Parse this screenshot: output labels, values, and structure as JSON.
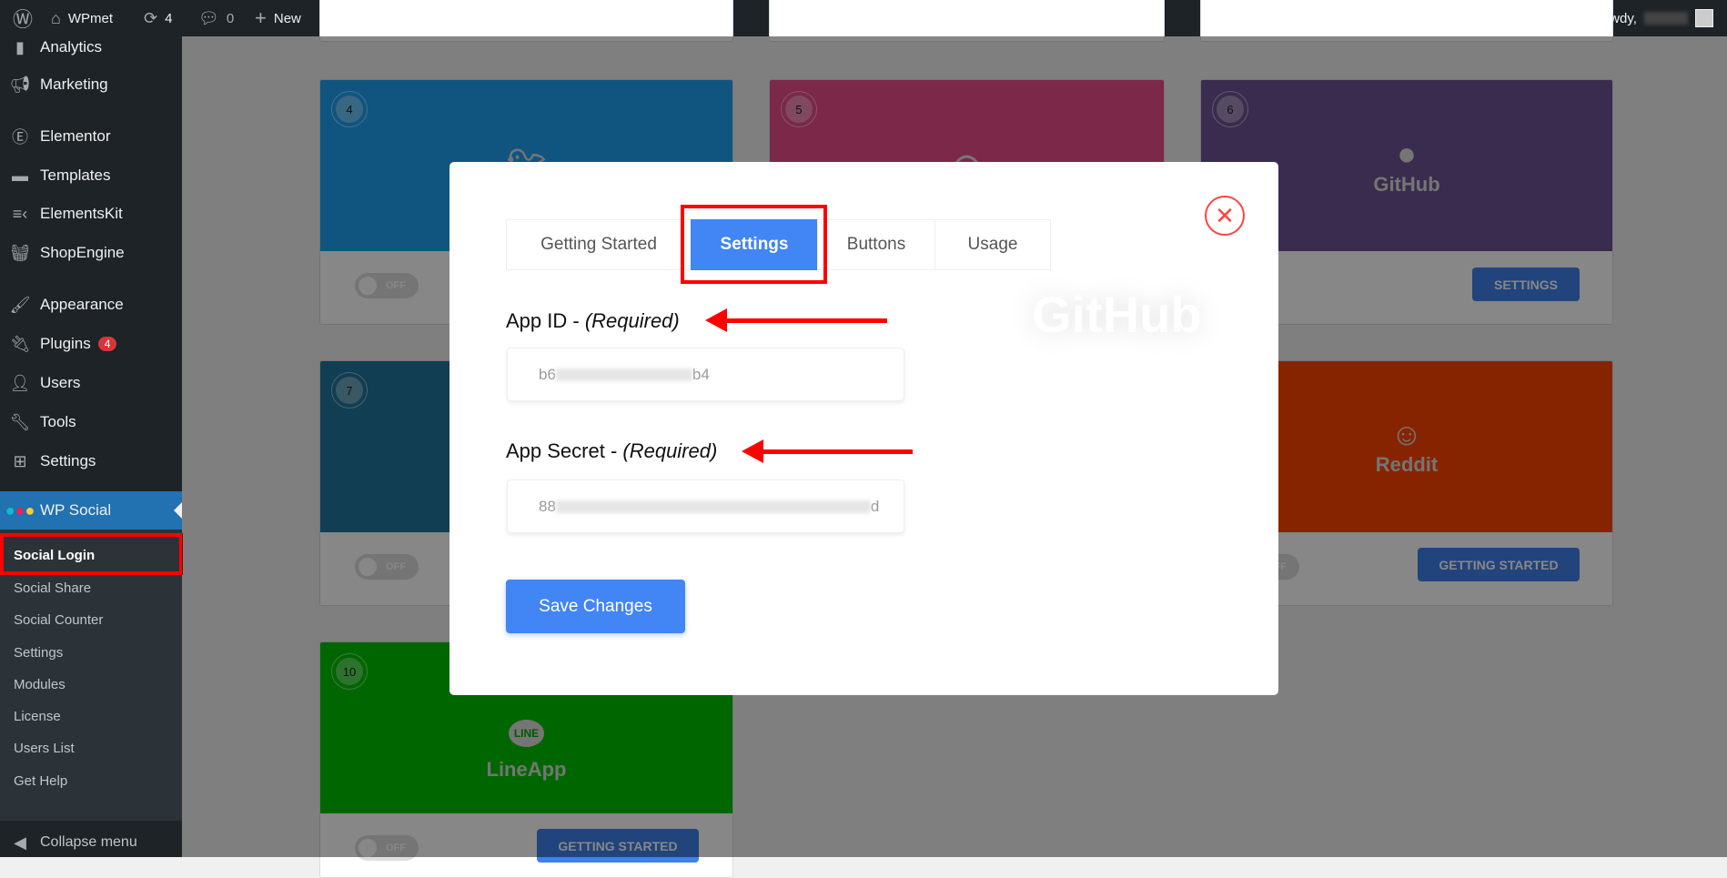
{
  "topbar": {
    "site": "WPmet",
    "updates": "4",
    "comments": "0",
    "new": "New",
    "howdy": "Howdy,"
  },
  "sidebar": {
    "items": [
      {
        "label": "Analytics"
      },
      {
        "label": "Marketing"
      },
      {
        "label": "Elementor"
      },
      {
        "label": "Templates"
      },
      {
        "label": "ElementsKit"
      },
      {
        "label": "ShopEngine"
      },
      {
        "label": "Appearance"
      },
      {
        "label": "Plugins",
        "badge": "4"
      },
      {
        "label": "Users"
      },
      {
        "label": "Tools"
      },
      {
        "label": "Settings"
      },
      {
        "label": "WP Social"
      }
    ],
    "submenu": [
      "Social Login",
      "Social Share",
      "Social Counter",
      "Settings",
      "Modules",
      "License",
      "Users List",
      "Get Help"
    ],
    "collapse": "Collapse menu"
  },
  "cards": [
    {
      "num": "4",
      "name": "",
      "color": "#1da1f2",
      "toggle": "OFF"
    },
    {
      "num": "5",
      "name": "",
      "color": "#ea4c89"
    },
    {
      "num": "6",
      "name": "GitHub",
      "color": "#6e5494",
      "button": "SETTINGS"
    },
    {
      "num": "7",
      "name": "",
      "color": "#21759b",
      "toggle": "OFF"
    },
    {
      "num": "",
      "name": "Reddit",
      "color": "#ff4500",
      "toggle": "OFF",
      "button": "GETTING STARTED"
    },
    {
      "num": "10",
      "name": "LineApp",
      "color": "#00c300",
      "toggle": "OFF",
      "button": "GETTING STARTED"
    }
  ],
  "modal": {
    "tabs": [
      "Getting Started",
      "Settings",
      "Buttons",
      "Usage"
    ],
    "active_tab": "Settings",
    "app_id_label": "App ID - ",
    "app_secret_label": "App Secret - ",
    "required": "(Required)",
    "app_id_prefix": "b6",
    "app_id_suffix": "b4",
    "app_secret_prefix": "88",
    "app_secret_suffix": "d",
    "save": "Save Changes",
    "watermark": "GitHub"
  },
  "colors": {
    "accent": "#4285f4",
    "annotation": "#ff0000",
    "wp_blue": "#2271b1"
  }
}
